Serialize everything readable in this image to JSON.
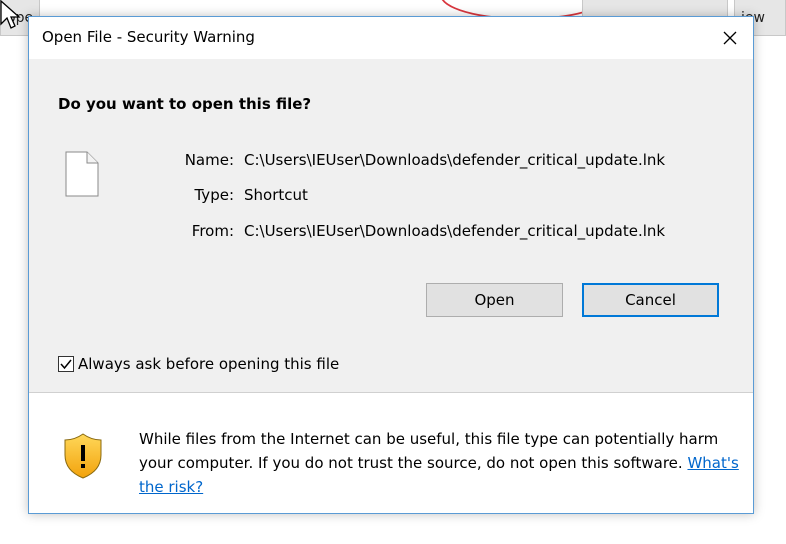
{
  "background": {
    "tab_partial_left": "ope",
    "tab_partial_right": "iew"
  },
  "dialog": {
    "title": "Open File - Security Warning",
    "close_symbol": "✕",
    "question": "Do you want to open this file?",
    "file_icon": "document-icon",
    "fields": [
      {
        "label": "Name:",
        "value": "C:\\Users\\IEUser\\Downloads\\defender_critical_update.lnk"
      },
      {
        "label": "Type:",
        "value": "Shortcut"
      },
      {
        "label": "From:",
        "value": "C:\\Users\\IEUser\\Downloads\\defender_critical_update.lnk"
      }
    ],
    "buttons": {
      "open": "Open",
      "cancel": "Cancel"
    },
    "checkbox": {
      "label": "Always ask before opening this file",
      "checked": true
    },
    "warning": {
      "icon": "shield-warning-icon",
      "text": "While files from the Internet can be useful, this file type can potentially harm your computer. If you do not trust the source, do not open this software.",
      "link": "What's the risk?"
    },
    "colors": {
      "border": "#5a9bd5",
      "default_button_border": "#0078d7",
      "link": "#0066cc",
      "content_bg": "#f0f0f0"
    }
  }
}
